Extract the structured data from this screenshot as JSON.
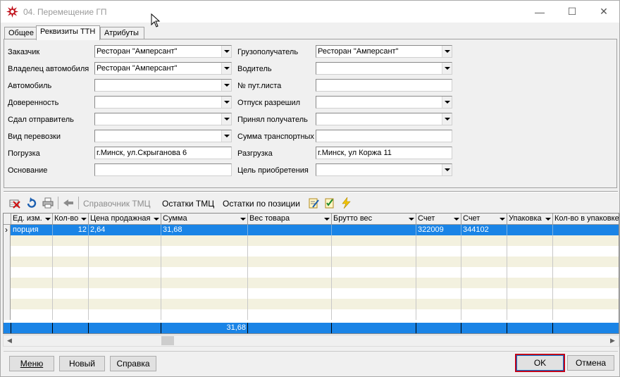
{
  "window": {
    "title": "04. Перемещение ГП",
    "controls": {
      "minimize": "—",
      "maximize": "☐",
      "close": "✕"
    }
  },
  "tabs": [
    {
      "label": "Общее",
      "active": false
    },
    {
      "label": "Реквизиты ТТН",
      "active": true
    },
    {
      "label": "Атрибуты",
      "active": false
    }
  ],
  "form": {
    "left": [
      {
        "label": "Заказчик",
        "value": "Ресторан \"Амперсант\"",
        "type": "combo"
      },
      {
        "label": "Владелец автомобиля",
        "value": "Ресторан \"Амперсант\"",
        "type": "combo"
      },
      {
        "label": "Автомобиль",
        "value": "",
        "type": "combo"
      },
      {
        "label": "Доверенность",
        "value": "",
        "type": "combo"
      },
      {
        "label": "Сдал отправитель",
        "value": "",
        "type": "combo"
      },
      {
        "label": "Вид перевозки",
        "value": "",
        "type": "combo"
      },
      {
        "label": "Погрузка",
        "value": "г.Минск, ул.Скрыганова 6",
        "type": "text"
      },
      {
        "label": "Основание",
        "value": "",
        "type": "text"
      }
    ],
    "right": [
      {
        "label": "Грузополучатель",
        "value": "Ресторан \"Амперсант\"",
        "type": "combo"
      },
      {
        "label": "Водитель",
        "value": "",
        "type": "combo"
      },
      {
        "label": "№ пут.листа",
        "value": "",
        "type": "text"
      },
      {
        "label": "Отпуск разрешил",
        "value": "",
        "type": "combo"
      },
      {
        "label": "Принял получатель",
        "value": "",
        "type": "combo"
      },
      {
        "label": "Сумма транспортных",
        "value": "",
        "type": "text"
      },
      {
        "label": "Разгрузка",
        "value": "г.Минск, ул Коржа 11",
        "type": "text"
      },
      {
        "label": "Цель приобретения",
        "value": "",
        "type": "combo"
      }
    ]
  },
  "toolbar": {
    "icons": [
      "delete-row-icon",
      "refresh-icon",
      "print-icon",
      "import-icon"
    ],
    "directory_label": "Справочник ТМЦ",
    "stock_label": "Остатки ТМЦ",
    "stock_by_position_label": "Остатки по позиции",
    "extra_icons": [
      "edit-note-icon",
      "checklist-icon",
      "lightning-icon"
    ]
  },
  "grid": {
    "columns": [
      "Ед. изм.",
      "Кол-во",
      "Цена продажная",
      "Сумма",
      "Вес товара",
      "Брутто вес",
      "Счет",
      "Счет",
      "Упаковка",
      "Кол-во в упаковке"
    ],
    "rows": [
      [
        "порция",
        "12",
        "2,64",
        "31,68",
        "",
        "",
        "322009",
        "344102",
        "",
        ""
      ]
    ],
    "footer": [
      "",
      "",
      "",
      "31,68",
      "",
      "",
      "",
      "",
      "",
      ""
    ],
    "row_indicator": "›",
    "selection_color": "#1a84e6",
    "stripe_color": "#f3f1df"
  },
  "buttons": {
    "menu": "Меню",
    "new": "Новый",
    "help": "Справка",
    "ok": "OK",
    "cancel": "Отмена"
  }
}
